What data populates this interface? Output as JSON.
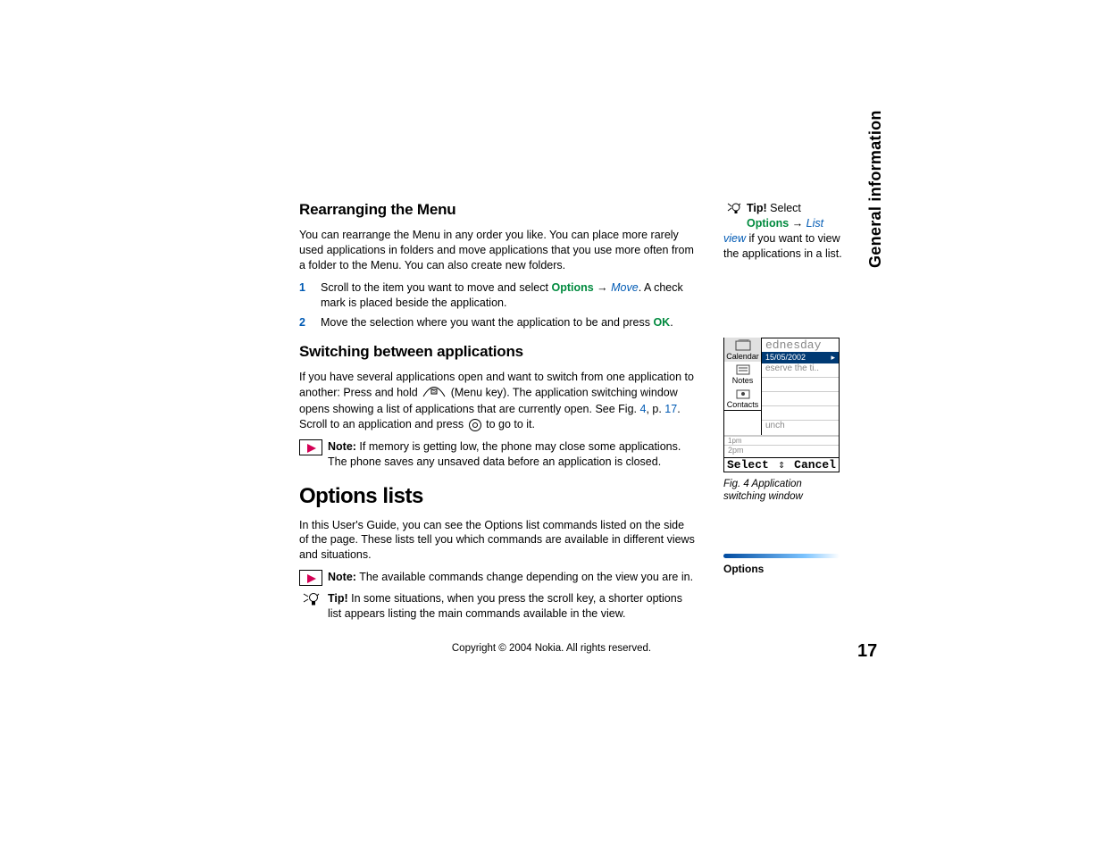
{
  "section_title": "General information",
  "page_number": "17",
  "copyright": "Copyright © 2004 Nokia. All rights reserved.",
  "h1": "Rearranging the Menu",
  "p1": "You can rearrange the Menu in any order you like. You can place more rarely used applications in folders and move applications that you use more often from a folder to the Menu. You can also create new folders.",
  "step1_a": "Scroll to the item you want to move and select ",
  "step1_opt": "Options",
  "step1_arrow": " → ",
  "step1_move": "Move",
  "step1_b": ". A check mark is placed beside the application.",
  "step2_a": "Move the selection where you want the application to be and press ",
  "step2_ok": "OK",
  "step2_b": ".",
  "h2": "Switching between applications",
  "p2a": "If you have several applications open and want to switch from one application to another: Press and hold ",
  "p2_menukey": " (Menu key). The application switching window opens showing a list of applications that are currently open. See Fig. ",
  "p2_fig": "4",
  "p2_p": ", p. ",
  "p2_pg": "17",
  "p2b": ". Scroll to an application and press ",
  "p2c": " to go to it.",
  "note1_label": "Note:",
  "note1": " If memory is getting low, the phone may close some applications. The phone saves any unsaved data before an application is closed.",
  "h3": "Options lists",
  "p3": "In this User's Guide, you can see the Options list commands listed on the side of the page. These lists tell you which commands are available in different views and situations.",
  "note2_label": "Note:",
  "note2": " The available commands change depending on the view you are in.",
  "tip2_label": "Tip!",
  "tip2": " In some situations, when you press the scroll key, a shorter options list appears listing the main commands available in the view.",
  "side_tip_label": "Tip!",
  "side_tip_a": " Select ",
  "side_tip_opt": "Options",
  "side_tip_arrow": " → ",
  "side_tip_listview": "List view",
  "side_tip_b": " if you want to view the applications in a list.",
  "fig": {
    "day": "ednesday",
    "date": "15/05/2002",
    "line1": "eserve the ti..",
    "line2": "unch",
    "time1": "1pm",
    "time2": "2pm",
    "app1": "Calendar",
    "app2": "Notes",
    "app3": "Contacts",
    "soft_left": "Select",
    "soft_mid": "⇕",
    "soft_right": "Cancel",
    "caption": "Fig. 4 Application switching window"
  },
  "options_label": "Options"
}
